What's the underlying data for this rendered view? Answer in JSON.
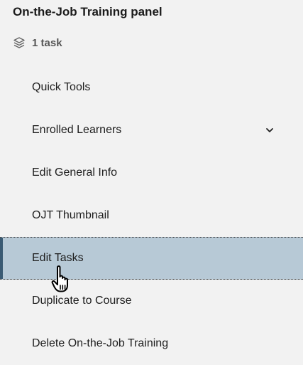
{
  "panel": {
    "title": "On-the-Job Training panel",
    "task_count_label": "1 task",
    "task_count_icon": "layers-icon"
  },
  "menu": {
    "items": [
      {
        "label": "Quick Tools"
      },
      {
        "label": "Enrolled Learners",
        "has_chevron": true,
        "chevron_icon": "chevron-down-icon"
      },
      {
        "label": "Edit General Info"
      },
      {
        "label": "OJT Thumbnail"
      },
      {
        "label": "Edit Tasks",
        "active": true
      },
      {
        "label": "Duplicate to Course"
      },
      {
        "label": "Delete On-the-Job Training"
      }
    ]
  },
  "colors": {
    "background": "#f2f2f2",
    "active_bg": "#b7c9d6",
    "active_accent": "#3a5a73"
  },
  "cursor_icon": "hand-pointer-icon"
}
